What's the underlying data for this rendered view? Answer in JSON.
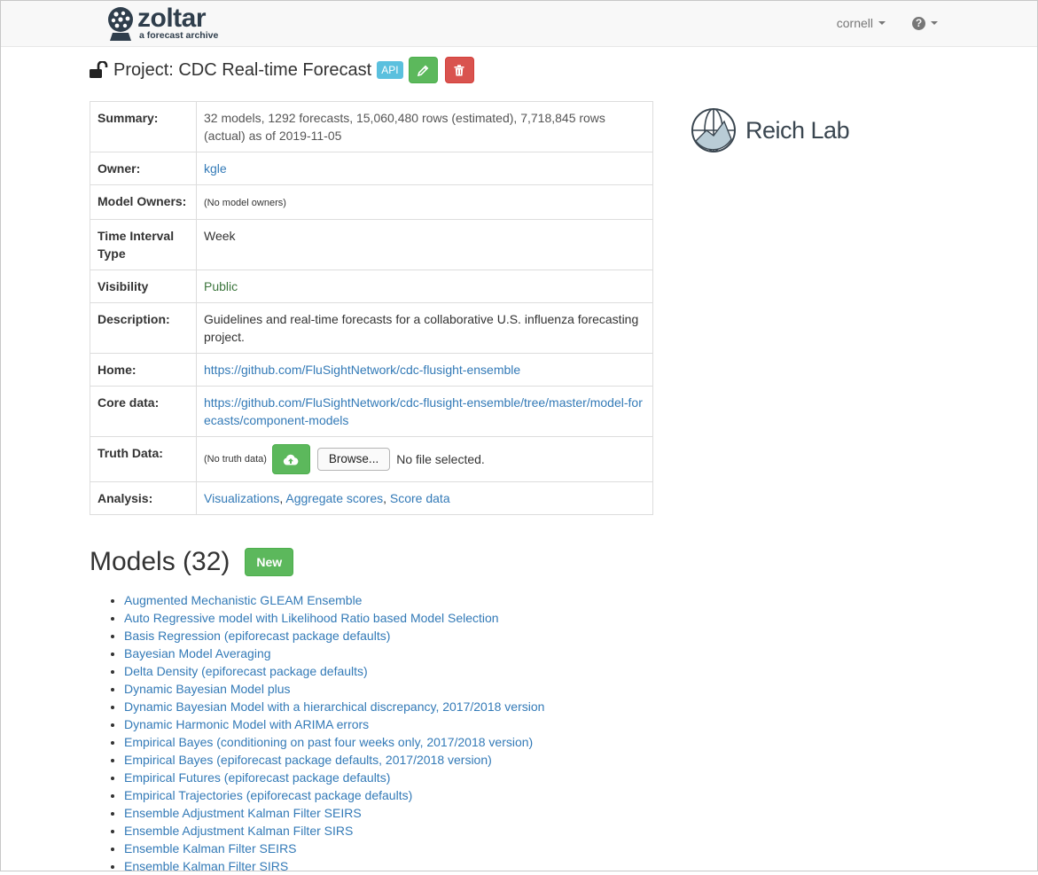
{
  "navbar": {
    "brand_name": "zoltar",
    "brand_tagline": "a forecast archive",
    "user_menu": "cornell",
    "help_icon": "question-circle-icon"
  },
  "project": {
    "title": "Project: CDC Real-time Forecast",
    "api_label": "API",
    "lock_icon": "unlock-icon",
    "edit_icon": "pencil-icon",
    "delete_icon": "trash-icon"
  },
  "info": {
    "summary_label": "Summary:",
    "summary_value": "32 models, 1292 forecasts, 15,060,480 rows (estimated), 7,718,845 rows (actual) as of 2019-11-05",
    "owner_label": "Owner:",
    "owner_value": "kgle",
    "model_owners_label": "Model Owners:",
    "model_owners_value": "(No model owners)",
    "time_interval_label": "Time Interval Type",
    "time_interval_value": "Week",
    "visibility_label": "Visibility",
    "visibility_value": "Public",
    "description_label": "Description:",
    "description_value": "Guidelines and real-time forecasts for a collaborative U.S. influenza forecasting project.",
    "home_label": "Home:",
    "home_value": "https://github.com/FluSightNetwork/cdc-flusight-ensemble",
    "core_data_label": "Core data:",
    "core_data_value": "https://github.com/FluSightNetwork/cdc-flusight-ensemble/tree/master/model-forecasts/component-models",
    "truth_data_label": "Truth Data:",
    "truth_data_value": "(No truth data)",
    "browse_label": "Browse...",
    "no_file_label": "No file selected.",
    "analysis_label": "Analysis:",
    "analysis_links": [
      "Visualizations",
      "Aggregate scores",
      "Score data"
    ],
    "analysis_sep": ", "
  },
  "reich_lab": {
    "label": "Reich Lab"
  },
  "models": {
    "title": "Models (32)",
    "new_label": "New",
    "items": [
      "Augmented Mechanistic GLEAM Ensemble",
      "Auto Regressive model with Likelihood Ratio based Model Selection",
      "Basis Regression (epiforecast package defaults)",
      "Bayesian Model Averaging",
      "Delta Density (epiforecast package defaults)",
      "Dynamic Bayesian Model plus",
      "Dynamic Bayesian Model with a hierarchical discrepancy, 2017/2018 version",
      "Dynamic Harmonic Model with ARIMA errors",
      "Empirical Bayes (conditioning on past four weeks only, 2017/2018 version)",
      "Empirical Bayes (epiforecast package defaults, 2017/2018 version)",
      "Empirical Futures (epiforecast package defaults)",
      "Empirical Trajectories (epiforecast package defaults)",
      "Ensemble Adjustment Kalman Filter SEIRS",
      "Ensemble Adjustment Kalman Filter SIRS",
      "Ensemble Kalman Filter SEIRS",
      "Ensemble Kalman Filter SIRS"
    ]
  },
  "colors": {
    "link": "#337ab7",
    "success": "#5cb85c",
    "danger": "#d9534f",
    "info": "#5bc0de",
    "public": "#3c763d"
  }
}
